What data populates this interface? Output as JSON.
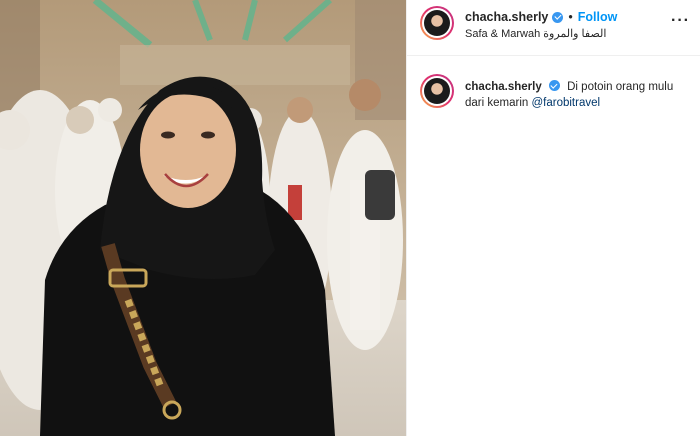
{
  "post": {
    "username": "chacha.sherly",
    "verified": true,
    "follow_label": "Follow",
    "separator": "•",
    "location": "Safa & Marwah الصفا والمروة",
    "more_label": "···"
  },
  "caption": {
    "username": "chacha.sherly",
    "verified": true,
    "text": "Di potoin orang mulu dari kemarin",
    "mention": "@farobitravel"
  },
  "colors": {
    "accent": "#0095f6",
    "verified": "#3897f0",
    "mention": "#00376b"
  },
  "photo": {
    "icon": "photo-image"
  }
}
